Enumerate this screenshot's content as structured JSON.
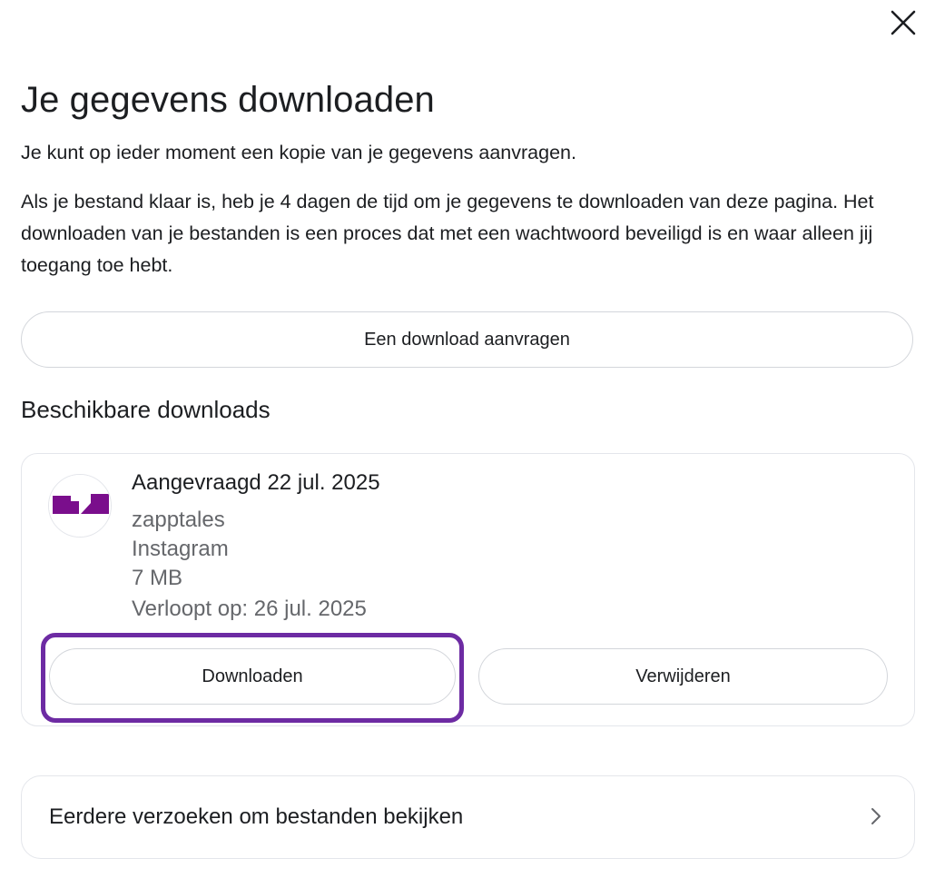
{
  "dialog": {
    "title": "Je gegevens downloaden",
    "intro": "Je kunt op ieder moment een kopie van je gegevens aanvragen.",
    "description": "Als je bestand klaar is, heb je 4 dagen de tijd om je gegevens te downloaden van deze pagina. Het downloaden van je bestanden is een proces dat met een wachtwoord beveiligd is en waar alleen jij toegang toe hebt.",
    "request_button_label": "Een download aanvragen",
    "close_icon": "close-icon"
  },
  "available_downloads": {
    "heading": "Beschikbare downloads",
    "items": [
      {
        "requested": "Aangevraagd 22 jul. 2025",
        "account": "zapptales",
        "platform": "Instagram",
        "size": "7 MB",
        "expires": "Verloopt op: 26 jul. 2025",
        "download_label": "Downloaden",
        "delete_label": "Verwijderen",
        "avatar_color": "#7a0e8c"
      }
    ]
  },
  "history": {
    "label": "Eerdere verzoeken om bestanden bekijken",
    "icon": "chevron-right-icon"
  },
  "highlight_color": "#6d2ba3"
}
